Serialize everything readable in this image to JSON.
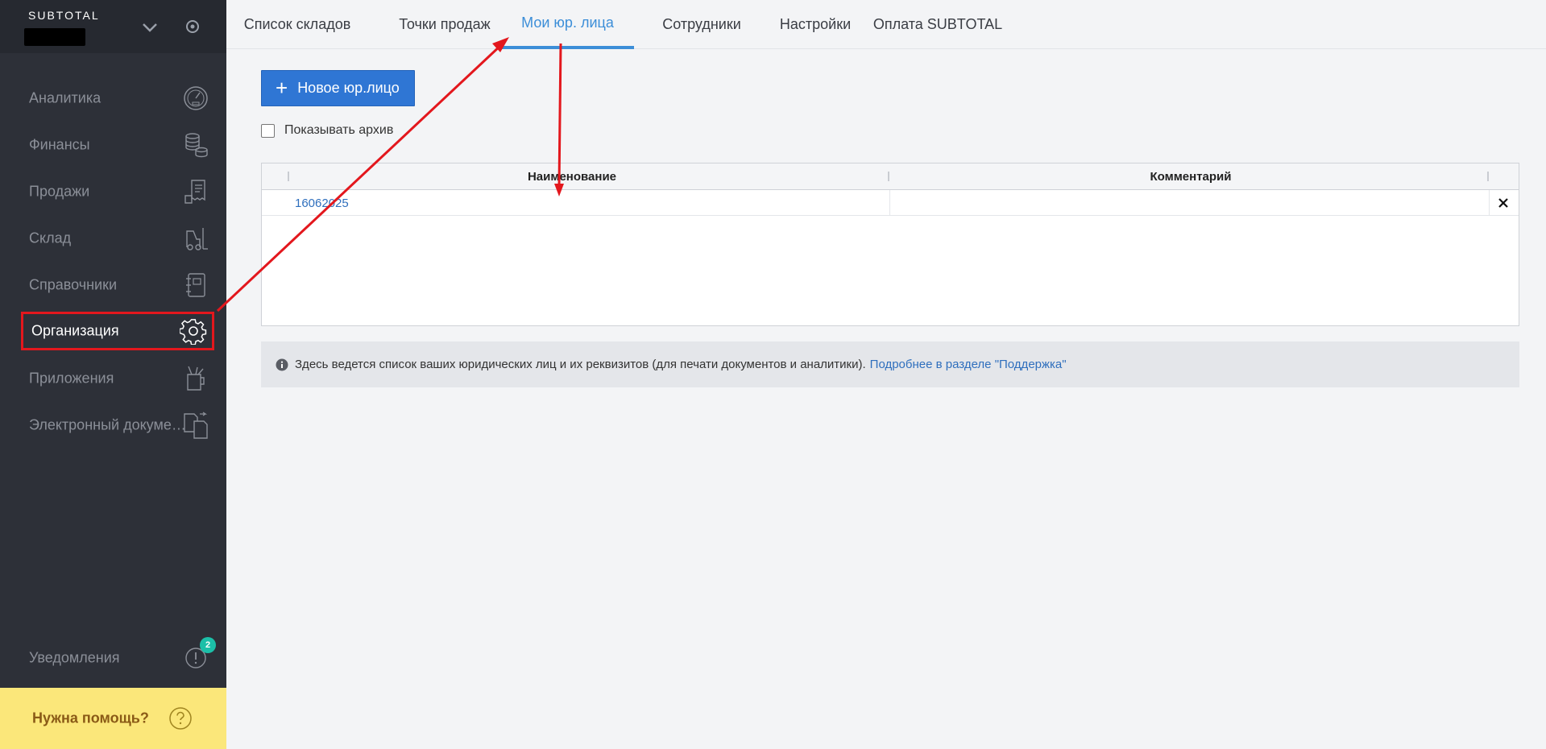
{
  "brand": {
    "name": "SUBTOTAL"
  },
  "sidebar": {
    "items": [
      {
        "label": "Аналитика"
      },
      {
        "label": "Финансы"
      },
      {
        "label": "Продажи"
      },
      {
        "label": "Склад"
      },
      {
        "label": "Справочники"
      },
      {
        "label": "Организация"
      },
      {
        "label": "Приложения"
      },
      {
        "label": "Электронный докуме…"
      }
    ],
    "notifications": {
      "label": "Уведомления",
      "count": "2"
    },
    "help": {
      "label": "Нужна помощь?"
    }
  },
  "tabs": [
    {
      "label": "Список складов"
    },
    {
      "label": "Точки продаж"
    },
    {
      "label": "Мои юр. лица"
    },
    {
      "label": "Сотрудники"
    },
    {
      "label": "Настройки"
    },
    {
      "label": "Оплата SUBTOTAL"
    }
  ],
  "main": {
    "new_button": "Новое юр.лицо",
    "show_archive": "Показывать архив",
    "table": {
      "headers": [
        "Наименование",
        "Комментарий"
      ],
      "rows": [
        {
          "name": "16062025",
          "comment": ""
        }
      ]
    },
    "info": {
      "text": "Здесь ведется список ваших юридических лиц и их реквизитов (для печати документов и аналитики).",
      "link": "Подробнее в разделе \"Поддержка\""
    }
  },
  "colors": {
    "sidebar": "#2d3038",
    "accent": "#3c8ed8",
    "button": "#2f76d4",
    "help": "#fbe77a",
    "annotation": "#e3171d",
    "badge": "#1cbfa8"
  }
}
